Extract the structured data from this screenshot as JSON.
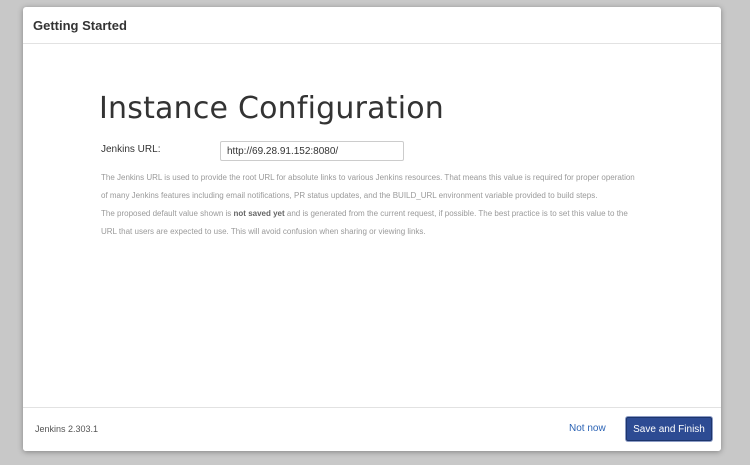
{
  "dialog": {
    "title": "Getting Started"
  },
  "main": {
    "heading": "Instance Configuration",
    "jenkins_url_label": "Jenkins URL:",
    "jenkins_url_value": "http://69.28.91.152:8080/",
    "help_paragraph_1": "The Jenkins URL is used to provide the root URL for absolute links to various Jenkins resources. That means this value is required for proper operation of many Jenkins features including email notifications, PR status updates, and the BUILD_URL environment variable provided to build steps.",
    "help_paragraph_2_before": "The proposed default value shown is ",
    "help_paragraph_2_bold": "not saved yet",
    "help_paragraph_2_after": " and is generated from the current request, if possible. The best practice is to set this value to the URL that users are expected to use. This will avoid confusion when sharing or viewing links."
  },
  "footer": {
    "version": "Jenkins 2.303.1",
    "not_now_label": "Not now",
    "save_label": "Save and Finish"
  },
  "colors": {
    "primary_button": "#2d4b93",
    "link": "#2b63b5",
    "help_text": "#9a9a9a"
  }
}
